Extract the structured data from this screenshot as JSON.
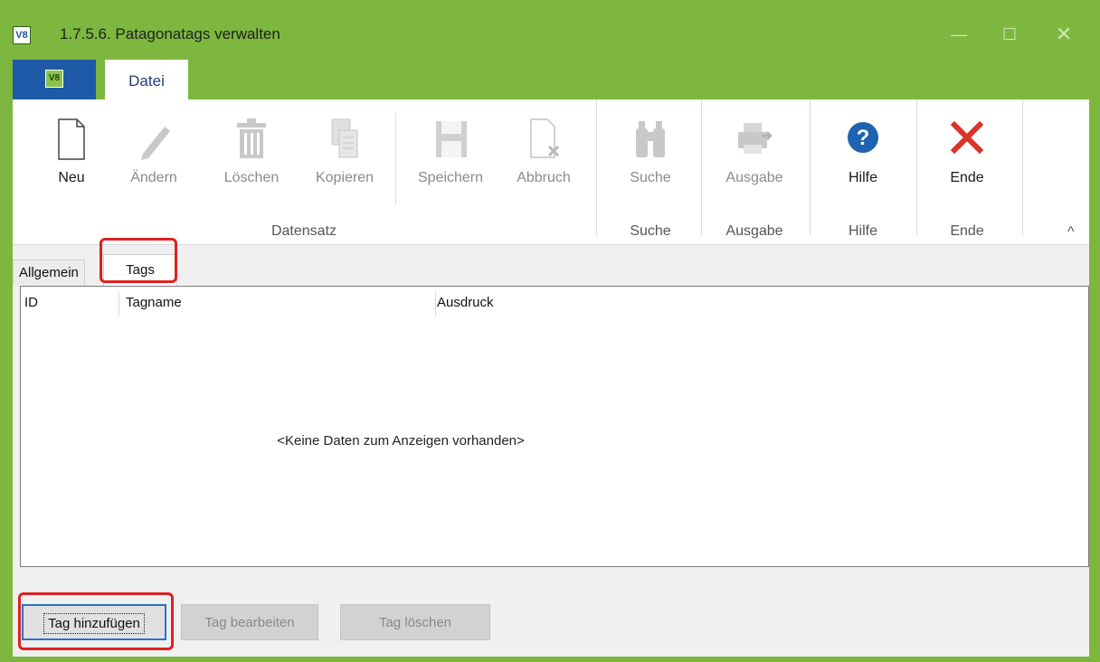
{
  "window": {
    "title": "1.7.5.6. Patagonatags verwalten",
    "app_icon_text": "V8",
    "controls": {
      "minimize": "—",
      "maximize": "☐",
      "close": "✕"
    }
  },
  "ribbon": {
    "app_tab_text": "V8",
    "tab_label": "Datei",
    "buttons": {
      "neu": "Neu",
      "aendern": "Ändern",
      "loeschen": "Löschen",
      "kopieren": "Kopieren",
      "speichern": "Speichern",
      "abbruch": "Abbruch",
      "suche": "Suche",
      "ausgabe": "Ausgabe",
      "hilfe": "Hilfe",
      "ende": "Ende"
    },
    "groups": {
      "datensatz": "Datensatz",
      "suche": "Suche",
      "ausgabe": "Ausgabe",
      "hilfe": "Hilfe",
      "ende": "Ende"
    },
    "collapse_glyph": "^",
    "colors": {
      "accent": "#7db73f",
      "app_tab": "#1e5aa8",
      "help_blue": "#1e62b0",
      "close_red": "#d9342b"
    }
  },
  "content": {
    "tabs": {
      "allgemein": "Allgemein",
      "tags": "Tags"
    },
    "grid": {
      "columns": {
        "id": "ID",
        "tagname": "Tagname",
        "ausdruck": "Ausdruck"
      },
      "empty_text": "<Keine Daten zum Anzeigen vorhanden>"
    },
    "buttons": {
      "add": "Tag hinzufügen",
      "edit": "Tag bearbeiten",
      "delete": "Tag löschen"
    }
  }
}
